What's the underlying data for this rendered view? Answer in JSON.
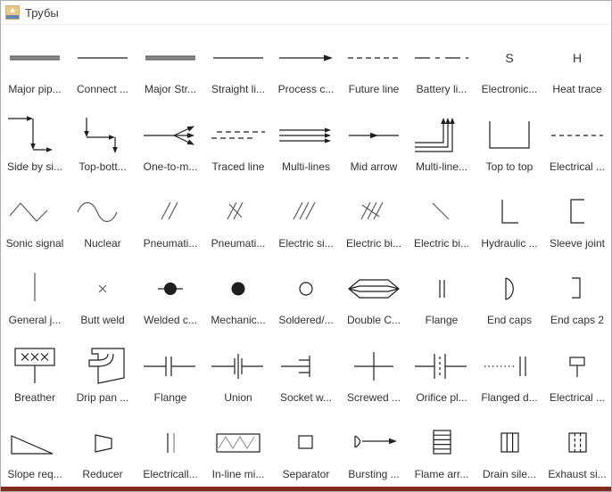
{
  "window": {
    "title": "Трубы"
  },
  "colors": {
    "bottom_bar": "#7e2b1d",
    "thick_line": "#8a8a8a",
    "symbol_black": "#1f1f1f",
    "symbol_gray": "#5a5a5a"
  },
  "items": [
    {
      "label": "Major pip...",
      "icon": "major-pipeline"
    },
    {
      "label": "Connect ...",
      "icon": "connector"
    },
    {
      "label": "Major Str...",
      "icon": "major-stream"
    },
    {
      "label": "Straight li...",
      "icon": "straight-line"
    },
    {
      "label": "Process c...",
      "icon": "process-connection"
    },
    {
      "label": "Future line",
      "icon": "future-line"
    },
    {
      "label": "Battery li...",
      "icon": "battery-limit"
    },
    {
      "label": "Electronic...",
      "icon": "electronic",
      "glyph": "S"
    },
    {
      "label": "Heat trace",
      "icon": "heat-trace",
      "glyph": "H"
    },
    {
      "label": "Side by si...",
      "icon": "side-by-side"
    },
    {
      "label": "Top-bott...",
      "icon": "top-bottom"
    },
    {
      "label": "One-to-m...",
      "icon": "one-to-many"
    },
    {
      "label": "Traced line",
      "icon": "traced-line"
    },
    {
      "label": "Multi-lines",
      "icon": "multi-lines"
    },
    {
      "label": "Mid arrow",
      "icon": "mid-arrow"
    },
    {
      "label": "Multi-line...",
      "icon": "multi-line-up"
    },
    {
      "label": "Top to top",
      "icon": "top-to-top"
    },
    {
      "label": "Electrical ...",
      "icon": "electrical-heat"
    },
    {
      "label": "Sonic signal",
      "icon": "sonic-signal"
    },
    {
      "label": "Nuclear",
      "icon": "nuclear"
    },
    {
      "label": "Pneumati...",
      "icon": "pneumatic-1"
    },
    {
      "label": "Pneumati...",
      "icon": "pneumatic-2"
    },
    {
      "label": "Electric si...",
      "icon": "electric-signal"
    },
    {
      "label": "Electric bi...",
      "icon": "electric-binary-1"
    },
    {
      "label": "Electric bi...",
      "icon": "electric-binary-2"
    },
    {
      "label": "Hydraulic ...",
      "icon": "hydraulic"
    },
    {
      "label": "Sleeve joint",
      "icon": "sleeve-joint"
    },
    {
      "label": "General j...",
      "icon": "general-joint"
    },
    {
      "label": "Butt weld",
      "icon": "butt-weld"
    },
    {
      "label": "Welded c...",
      "icon": "welded-connection"
    },
    {
      "label": "Mechanic...",
      "icon": "mechanical-connection"
    },
    {
      "label": "Soldered/...",
      "icon": "soldered"
    },
    {
      "label": "Double C...",
      "icon": "double-containment"
    },
    {
      "label": "Flange",
      "icon": "flange-simple"
    },
    {
      "label": "End caps",
      "icon": "end-caps"
    },
    {
      "label": "End caps 2",
      "icon": "end-caps-2"
    },
    {
      "label": "Breather",
      "icon": "breather"
    },
    {
      "label": "Drip pan ...",
      "icon": "drip-pan"
    },
    {
      "label": "Flange",
      "icon": "flange-welded"
    },
    {
      "label": "Union",
      "icon": "union"
    },
    {
      "label": "Socket w...",
      "icon": "socket-weld"
    },
    {
      "label": "Screwed ...",
      "icon": "screwed"
    },
    {
      "label": "Orifice pl...",
      "icon": "orifice-plate"
    },
    {
      "label": "Flanged d...",
      "icon": "flanged-dashed"
    },
    {
      "label": "Electrical ...",
      "icon": "electrical-connection"
    },
    {
      "label": "Slope req...",
      "icon": "slope"
    },
    {
      "label": "Reducer",
      "icon": "reducer"
    },
    {
      "label": "Electricall...",
      "icon": "electrically-insulated"
    },
    {
      "label": "In-line mi...",
      "icon": "inline-mixer"
    },
    {
      "label": "Separator",
      "icon": "separator"
    },
    {
      "label": "Bursting ...",
      "icon": "bursting-disc"
    },
    {
      "label": "Flame arr...",
      "icon": "flame-arrester"
    },
    {
      "label": "Drain sile...",
      "icon": "drain-silencer"
    },
    {
      "label": "Exhaust si...",
      "icon": "exhaust-silencer"
    }
  ]
}
